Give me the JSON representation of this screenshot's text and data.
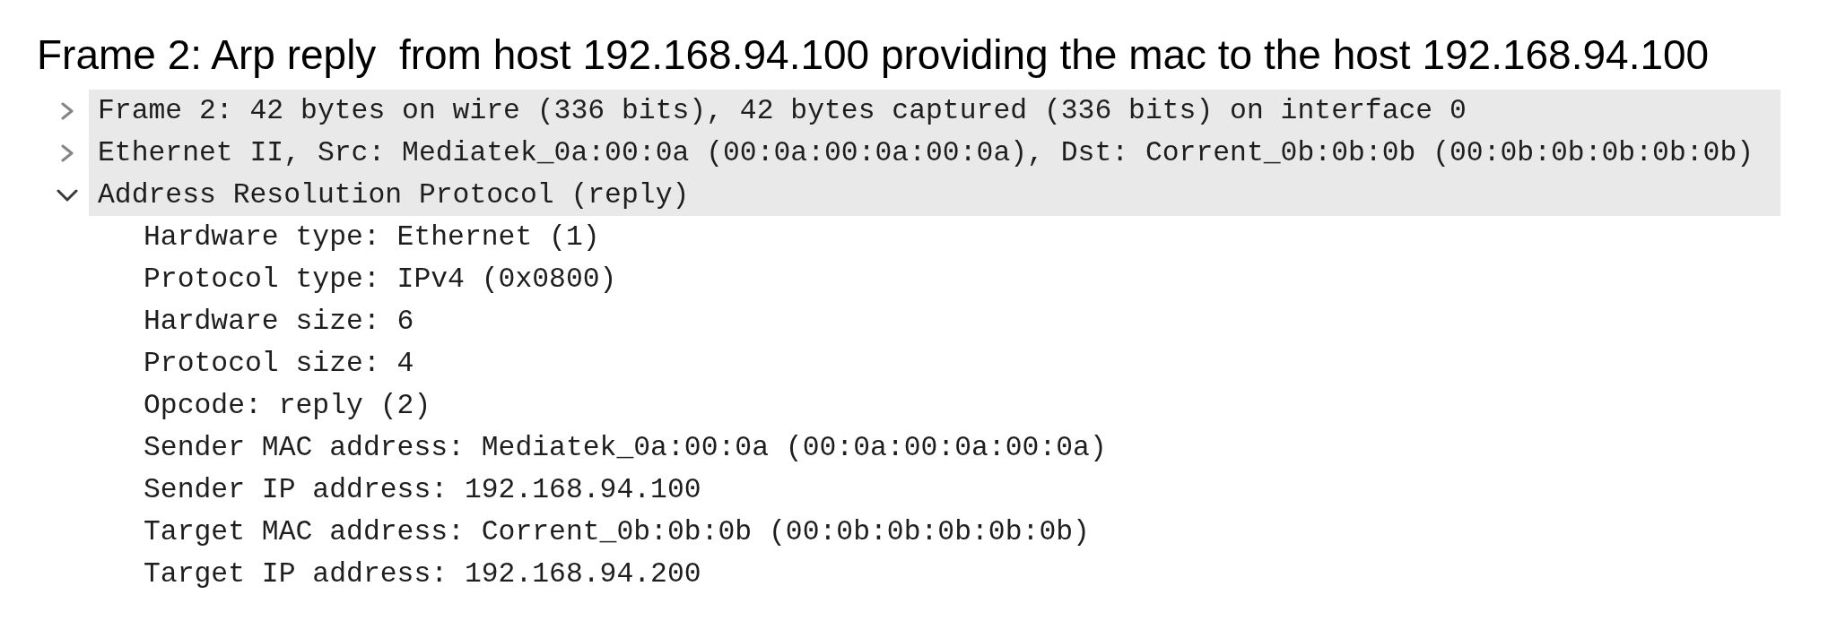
{
  "title": "Frame 2: Arp reply  from host 192.168.94.100 providing the mac to the host 192.168.94.100",
  "tree": [
    {
      "label": "Frame 2: 42 bytes on wire (336 bits), 42 bytes captured (336 bits) on interface 0",
      "expanded": false
    },
    {
      "label": "Ethernet II, Src: Mediatek_0a:00:0a (00:0a:00:0a:00:0a), Dst: Corrent_0b:0b:0b (00:0b:0b:0b:0b:0b)",
      "expanded": false
    },
    {
      "label": "Address Resolution Protocol (reply)",
      "expanded": true,
      "children": [
        {
          "label": "Hardware type: Ethernet (1)"
        },
        {
          "label": "Protocol type: IPv4 (0x0800)"
        },
        {
          "label": "Hardware size: 6"
        },
        {
          "label": "Protocol size: 4"
        },
        {
          "label": "Opcode: reply (2)"
        },
        {
          "label": "Sender MAC address: Mediatek_0a:00:0a (00:0a:00:0a:00:0a)"
        },
        {
          "label": "Sender IP address: 192.168.94.100"
        },
        {
          "label": "Target MAC address: Corrent_0b:0b:0b (00:0b:0b:0b:0b:0b)"
        },
        {
          "label": "Target IP address: 192.168.94.200"
        }
      ]
    }
  ]
}
